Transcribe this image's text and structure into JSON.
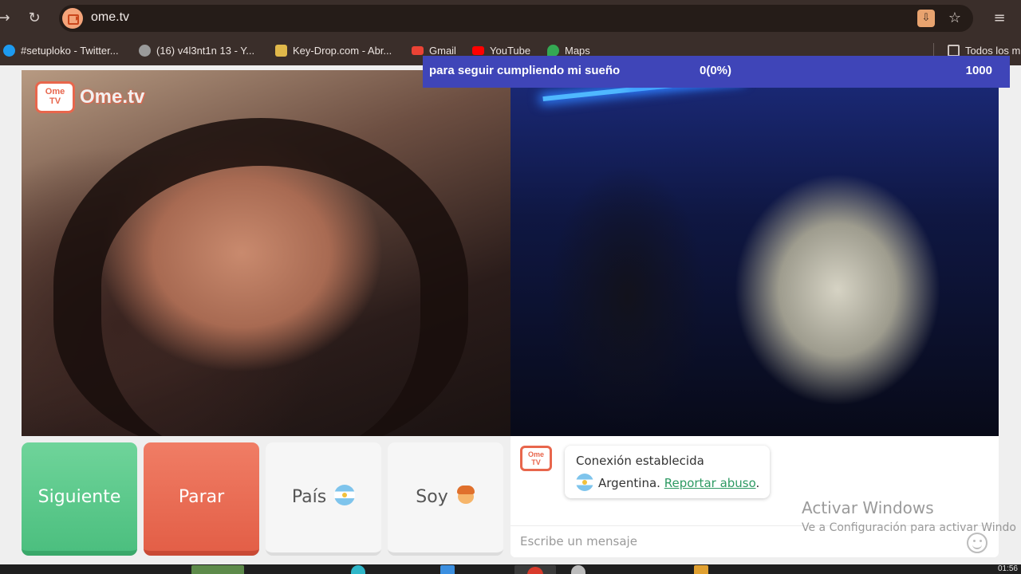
{
  "browser": {
    "url": "ome.tv",
    "bookmarks": [
      {
        "label": "#setuploko - Twitter...",
        "icon": "twitter-icon",
        "color": "#1d9bf0"
      },
      {
        "label": "(16) v4l3nt1n 13 - Y...",
        "icon": "globe-icon",
        "color": "#9a9a9a"
      },
      {
        "label": "Key-Drop.com - Abr...",
        "icon": "keydrop-icon",
        "color": "#e0b84a"
      },
      {
        "label": "Gmail",
        "icon": "gmail-icon",
        "color": "#ea4335"
      },
      {
        "label": "YouTube",
        "icon": "youtube-icon",
        "color": "#ff0000"
      },
      {
        "label": "Maps",
        "icon": "maps-icon",
        "color": "#34a853"
      },
      {
        "label": "Todos los m",
        "icon": "folder-icon",
        "color": "#cfc6c2"
      }
    ]
  },
  "banner": {
    "text": "para seguir cumpliendo mi sueño",
    "progress": "0(0%)",
    "goal": "1000",
    "color": "#3f45b8"
  },
  "logo": {
    "tv_label": "Ome TV",
    "text": "Ome.tv"
  },
  "controls": {
    "next_label": "Siguiente",
    "stop_label": "Parar",
    "country_label": "País",
    "me_label": "Soy"
  },
  "chat": {
    "logo_label": "Ome TV",
    "status_title": "Conexión establecida",
    "country": "Argentina.",
    "report_link": "Reportar abuso",
    "report_suffix": ".",
    "input_placeholder": "Escribe un mensaje"
  },
  "watermark": {
    "title": "Activar Windows",
    "subtitle": "Ve a Configuración para activar Windo"
  },
  "taskbar": {
    "time": "01:56"
  },
  "colors": {
    "next": "#4cbf7f",
    "stop": "#e35f47",
    "report_link": "#2e9a63"
  }
}
